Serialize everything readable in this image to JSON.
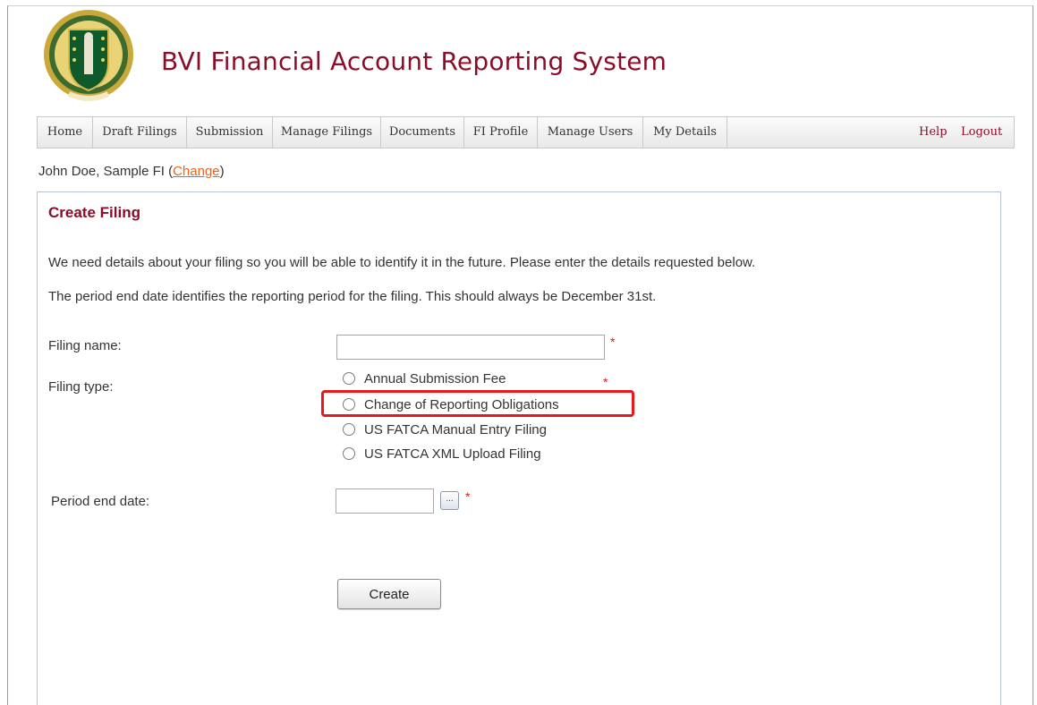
{
  "header": {
    "title": "BVI Financial Account Reporting System",
    "logo_icon": "bvi-coat-of-arms-seal-icon"
  },
  "nav": {
    "items": [
      "Home",
      "Draft Filings",
      "Submission",
      "Manage Filings",
      "Documents",
      "FI Profile",
      "Manage Users",
      "My Details"
    ],
    "help_label": "Help",
    "logout_label": "Logout"
  },
  "user": {
    "prefix": "John Doe, Sample FI (",
    "change_label": "Change",
    "suffix": ")"
  },
  "form": {
    "title": "Create Filing",
    "intro_1": "We need details about your filing so you will be able to identify it in the future. Please enter the details requested below.",
    "intro_2": "The period end date identifies the reporting period for the filing. This should always be December 31st.",
    "filing_name_label": "Filing name:",
    "filing_name_value": "",
    "filing_type_label": "Filing type:",
    "filing_types": [
      "Annual Submission Fee",
      "Change of Reporting Obligations",
      "US FATCA Manual Entry Filing",
      "US FATCA XML Upload Filing"
    ],
    "highlighted_option": "Change of Reporting Obligations",
    "period_end_label": "Period end date:",
    "period_end_value": "",
    "calendar_button_label": "...",
    "required_mark": "*",
    "create_label": "Create"
  },
  "colors": {
    "brand": "#8b0d28",
    "link": "#e8641b",
    "highlight": "#e8191c",
    "required": "#d91c1c"
  }
}
